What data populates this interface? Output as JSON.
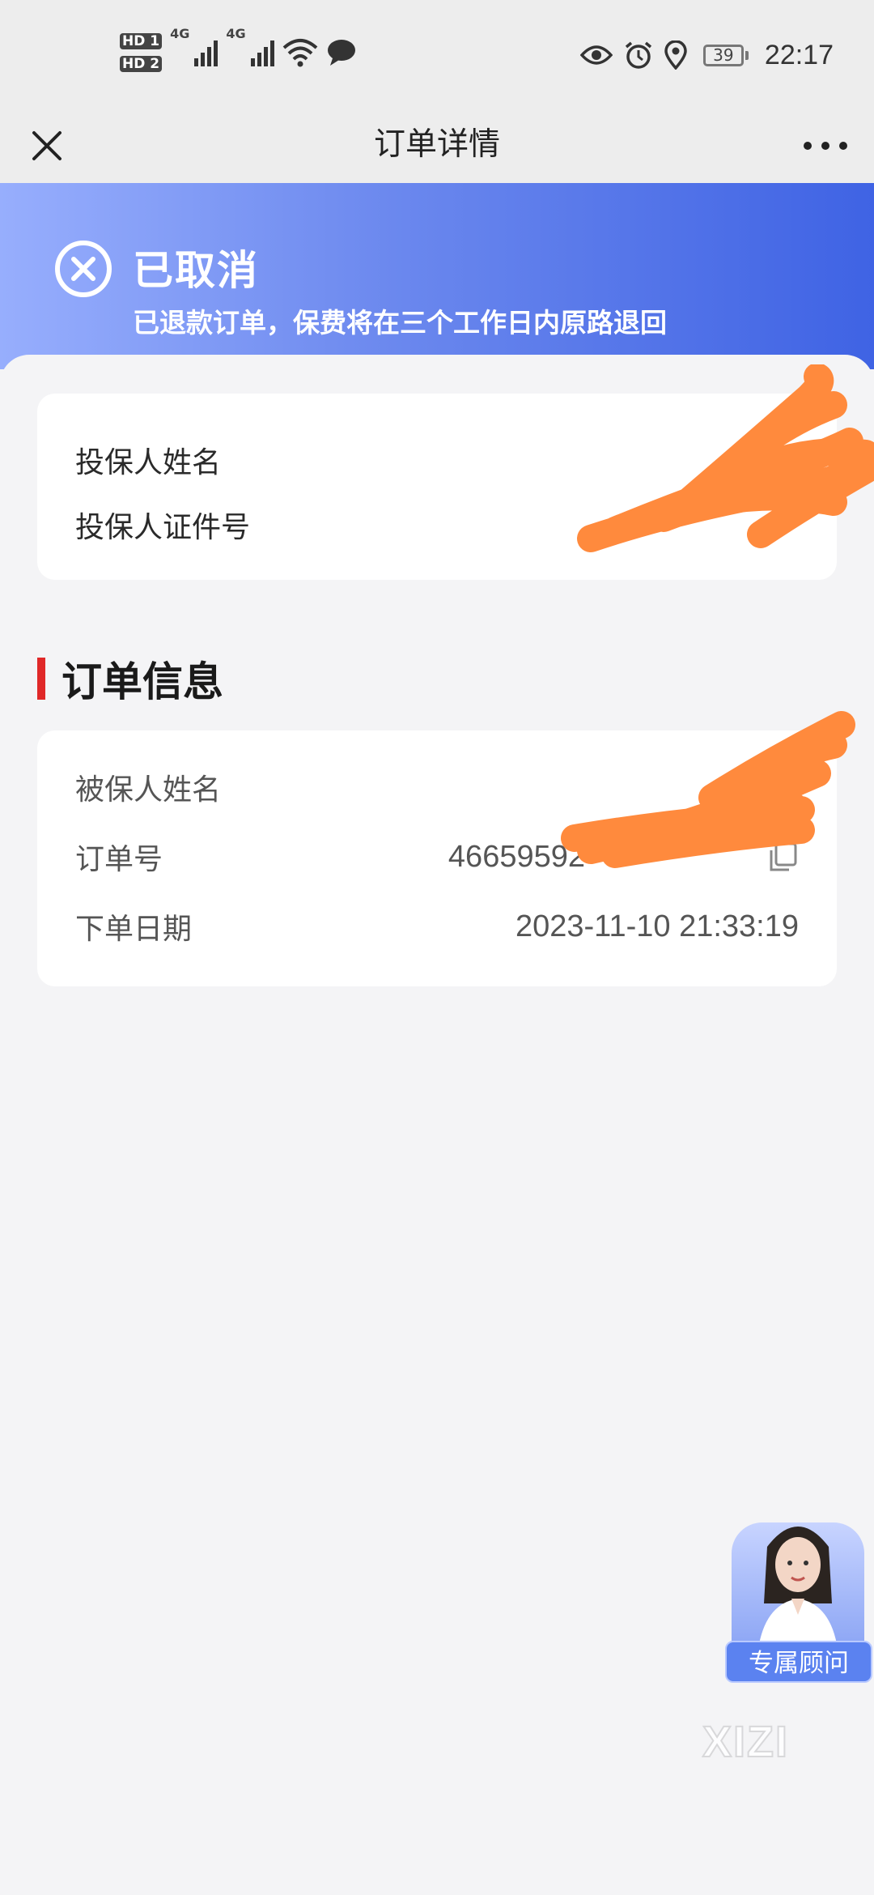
{
  "status_bar": {
    "hd1": "HD 1",
    "hd2": "HD 2",
    "sig1": "4G",
    "sig2": "4G",
    "battery": "39",
    "time": "22:17",
    "icons": [
      "eye-icon",
      "alarm-icon",
      "location-icon",
      "battery-icon",
      "wifi-icon",
      "chat-bubble-icon"
    ]
  },
  "nav": {
    "title": "订单详情",
    "close_icon": "close-icon",
    "more_icon": "more-icon"
  },
  "banner": {
    "status": "已取消",
    "message": "已退款订单，保费将在三个工作日内原路退回",
    "icon": "cancel-circle-icon",
    "gradient": [
      "#97aefd",
      "#3f63e4"
    ]
  },
  "policyholder": {
    "name_label": "投保人姓名",
    "id_label": "投保人证件号"
  },
  "order_info": {
    "section_title": "订单信息",
    "insured_name_label": "被保人姓名",
    "order_no_label": "订单号",
    "order_no_value": "46659592",
    "order_date_label": "下单日期",
    "order_date_value": "2023-11-10 21:33:19",
    "copy_icon": "copy-icon",
    "accent": "#e02828"
  },
  "advisor": {
    "label": "专属顾问"
  },
  "watermark": "XIZI",
  "redaction_color": "#ff8a3d"
}
